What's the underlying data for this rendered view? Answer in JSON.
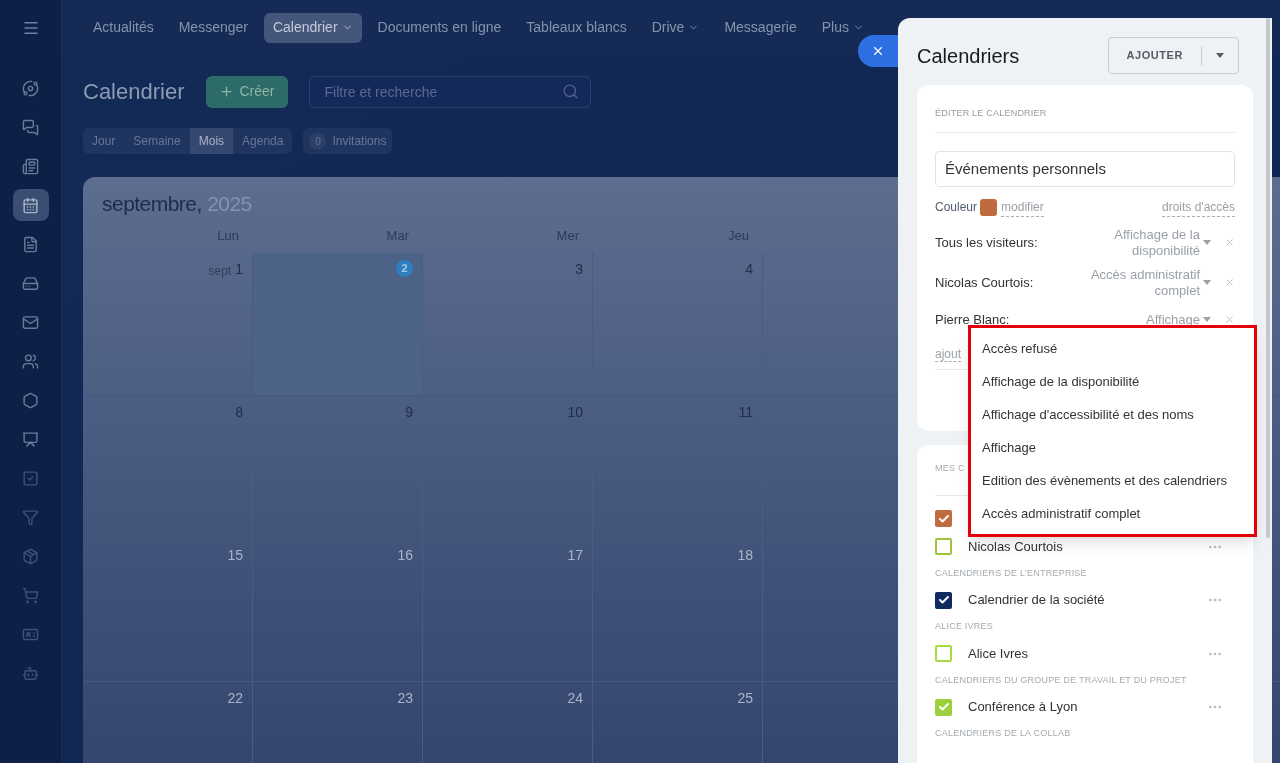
{
  "sidebar": {
    "items": [
      {
        "kind": "activity",
        "selected": false
      },
      {
        "kind": "chat",
        "selected": false
      },
      {
        "kind": "news",
        "selected": false
      },
      {
        "kind": "calendar",
        "selected": true
      },
      {
        "kind": "document",
        "selected": false
      },
      {
        "kind": "drive",
        "selected": false
      },
      {
        "kind": "mail",
        "selected": false
      },
      {
        "kind": "people",
        "selected": false
      },
      {
        "kind": "hexagon",
        "selected": false
      },
      {
        "kind": "board",
        "selected": false
      },
      {
        "kind": "task",
        "selected": false
      },
      {
        "kind": "funnel",
        "selected": false
      },
      {
        "kind": "box",
        "selected": false
      },
      {
        "kind": "cart",
        "selected": false
      },
      {
        "kind": "card",
        "selected": false
      },
      {
        "kind": "robot",
        "selected": false
      }
    ]
  },
  "top_nav": {
    "items": [
      {
        "label": "Actualités",
        "selected": false,
        "dropdown": false
      },
      {
        "label": "Messenger",
        "selected": false,
        "dropdown": false
      },
      {
        "label": "Calendrier",
        "selected": true,
        "dropdown": true
      },
      {
        "label": "Documents en ligne",
        "selected": false,
        "dropdown": false
      },
      {
        "label": "Tableaux blancs",
        "selected": false,
        "dropdown": false
      },
      {
        "label": "Drive",
        "selected": false,
        "dropdown": true
      },
      {
        "label": "Messagerie",
        "selected": false,
        "dropdown": false
      },
      {
        "label": "Plus",
        "selected": false,
        "dropdown": true
      }
    ]
  },
  "page": {
    "title": "Calendrier",
    "create_button": "Créer",
    "search": {
      "placeholder": "Filtre et recherche"
    },
    "view_tabs": [
      {
        "label": "Jour",
        "selected": false
      },
      {
        "label": "Semaine",
        "selected": false
      },
      {
        "label": "Mois",
        "selected": true
      },
      {
        "label": "Agenda",
        "selected": false
      }
    ],
    "invitations": {
      "count": "0",
      "label": "Invitations"
    }
  },
  "calendar": {
    "month": "septembre,",
    "year": "2025",
    "weekdays": [
      "Lun",
      "Mar",
      "Mer",
      "Jeu"
    ],
    "weeks": [
      [
        {
          "day": "1",
          "prefix": "sept",
          "today": false
        },
        {
          "day": "2",
          "today": true
        },
        {
          "day": "3",
          "today": false
        },
        {
          "day": "4",
          "today": false
        }
      ],
      [
        {
          "day": "8",
          "today": false
        },
        {
          "day": "9",
          "today": false
        },
        {
          "day": "10",
          "today": false
        },
        {
          "day": "11",
          "today": false
        }
      ],
      [
        {
          "day": "15",
          "today": false
        },
        {
          "day": "16",
          "today": false
        },
        {
          "day": "17",
          "today": false
        },
        {
          "day": "18",
          "today": false
        }
      ],
      [
        {
          "day": "22",
          "today": false
        },
        {
          "day": "23",
          "today": false
        },
        {
          "day": "24",
          "today": false
        },
        {
          "day": "25",
          "today": false
        }
      ]
    ]
  },
  "panel": {
    "title": "Calendriers",
    "add_button": "AJOUTER",
    "edit_card": {
      "heading": "ÉDITER LE CALENDRIER",
      "name_value": "Événements personnels",
      "color_label": "Couleur",
      "color": "#bf6b3d",
      "modify_link": "modifier",
      "rights_link": "droits d'accès",
      "access": [
        {
          "who": "Tous les visiteurs:",
          "level": "Affichage de la disponibilité"
        },
        {
          "who": "Nicolas Courtois:",
          "level": "Accès administratif complet"
        },
        {
          "who": "Pierre Blanc:",
          "level": "Affichage"
        }
      ],
      "add_link": "ajout"
    },
    "access_menu": {
      "options": [
        "Accès refusé",
        "Affichage de la disponibilité",
        "Affichage d'accessibilité et des noms",
        "Affichage",
        "Edition des évènements et des calendriers",
        "Accès administratif complet"
      ]
    },
    "list_card": {
      "groups": [
        {
          "heading": "MES C",
          "items": [
            {
              "color": "#bf6b3d",
              "checked": true
            },
            {
              "label": "Nicolas Courtois",
              "color": "#9cc33b",
              "checked": false
            }
          ]
        },
        {
          "heading": "CALENDRIERS DE L'ENTREPRISE",
          "items": [
            {
              "label": "Calendrier de la société",
              "color": "#0f2a5c",
              "checked": true
            }
          ]
        },
        {
          "heading": "ALICE IVRES",
          "items": [
            {
              "label": "Alice Ivres",
              "color": "#a8d843",
              "checked": false
            }
          ]
        },
        {
          "heading": "CALENDRIERS DU GROUPE DE TRAVAIL ET DU PROJET",
          "items": [
            {
              "label": "Conférence à Lyon",
              "color": "#9bd03c",
              "checked": true
            }
          ]
        },
        {
          "heading": "CALENDRIERS DE LA COLLAB"
        }
      ]
    }
  }
}
